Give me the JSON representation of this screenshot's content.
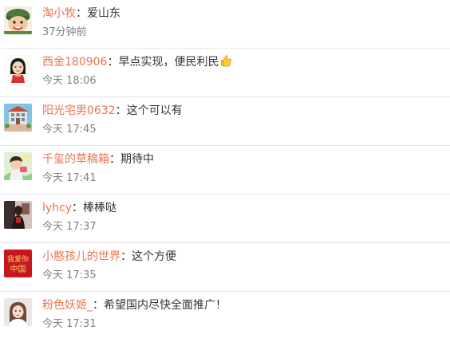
{
  "comments": [
    {
      "username": "淘小牧",
      "colon": "：",
      "text": "爱山东",
      "time": "37分钟前",
      "avatar_icon": "cartoon-soldier-avatar"
    },
    {
      "username": "西金180906",
      "colon": "：",
      "text": "早点实现，便民利民",
      "emoji": "thumbs-up-icon",
      "time": "今天 18:06",
      "avatar_icon": "cartoon-girl-avatar"
    },
    {
      "username": "阳光宅男0632",
      "colon": "：",
      "text": "这个可以有",
      "time": "今天 17:45",
      "avatar_icon": "building-photo-avatar"
    },
    {
      "username": "千玺的草稿箱",
      "colon": "：",
      "text": "期待中",
      "time": "今天 17:41",
      "avatar_icon": "person-photo-avatar"
    },
    {
      "username": "lyhcy",
      "colon": "：",
      "text": "棒棒哒",
      "time": "今天 17:37",
      "avatar_icon": "dark-photo-avatar"
    },
    {
      "username": "小憨孩儿的世界",
      "colon": "：",
      "text": "这个方便",
      "time": "今天 17:35",
      "avatar_icon": "china-love-avatar",
      "avatar_text": [
        "我爱你",
        "中国"
      ]
    },
    {
      "username": "粉色妖姬_",
      "colon": "：",
      "text": "希望国内尽快全面推广！",
      "time": "今天 17:31",
      "avatar_icon": "girl-photo-avatar"
    }
  ],
  "colors": {
    "username": "#eb7350",
    "text": "#333333",
    "time": "#808080",
    "divider": "#e6e6e6"
  }
}
